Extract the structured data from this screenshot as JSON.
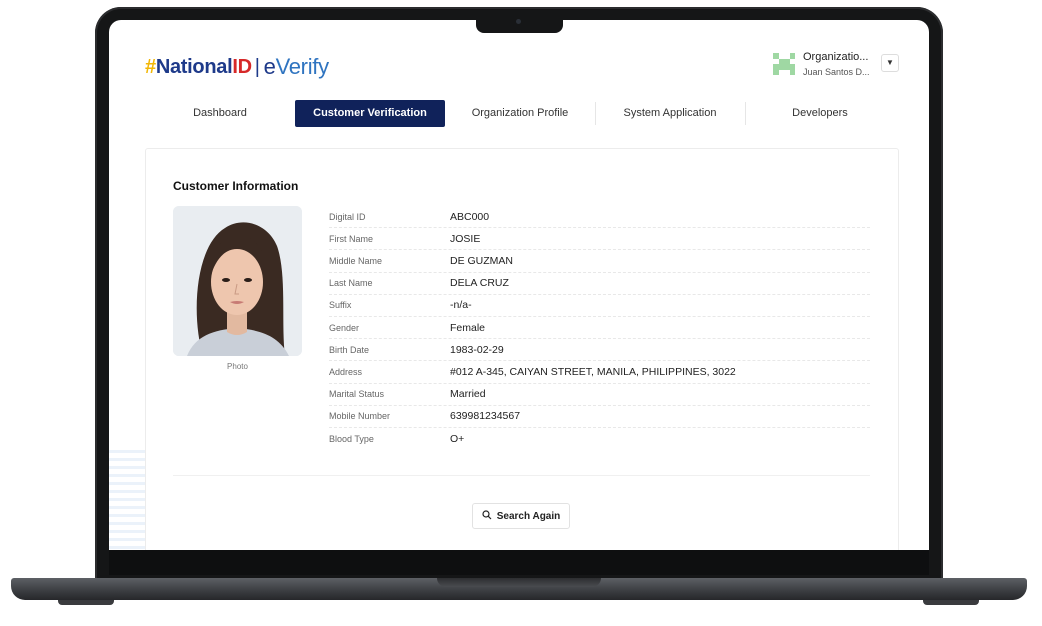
{
  "brand": {
    "hash": "#",
    "national": "National",
    "id": "ID",
    "separator": "|",
    "everify_e": "e",
    "everify_rest": "Verify"
  },
  "organization": {
    "name": "Organizatio...",
    "user": "Juan Santos D...",
    "dropdown_icon": "chevron-down-icon",
    "avatar_color": "#9fd8a3"
  },
  "nav": {
    "tabs": [
      {
        "label": "Dashboard",
        "active": false
      },
      {
        "label": "Customer Verification",
        "active": true
      },
      {
        "label": "Organization Profile",
        "active": false
      },
      {
        "label": "System Application",
        "active": false
      },
      {
        "label": "Developers",
        "active": false
      }
    ],
    "active_color": "#10225a"
  },
  "customer": {
    "title": "Customer Information",
    "photo_caption": "Photo",
    "fields": [
      {
        "label": "Digital ID",
        "value": "ABC000"
      },
      {
        "label": "First Name",
        "value": "JOSIE"
      },
      {
        "label": "Middle Name",
        "value": "DE GUZMAN"
      },
      {
        "label": "Last Name",
        "value": "DELA CRUZ"
      },
      {
        "label": "Suffix",
        "value": "-n/a-"
      },
      {
        "label": "Gender",
        "value": "Female"
      },
      {
        "label": "Birth Date",
        "value": "1983-02-29"
      },
      {
        "label": "Address",
        "value": "#012 A-345, CAIYAN STREET, MANILA, PHILIPPINES, 3022"
      },
      {
        "label": "Marital Status",
        "value": "Married"
      },
      {
        "label": "Mobile Number",
        "value": "639981234567"
      },
      {
        "label": "Blood Type",
        "value": "O+"
      }
    ]
  },
  "actions": {
    "search_again_label": "Search Again",
    "search_icon": "search-icon"
  }
}
